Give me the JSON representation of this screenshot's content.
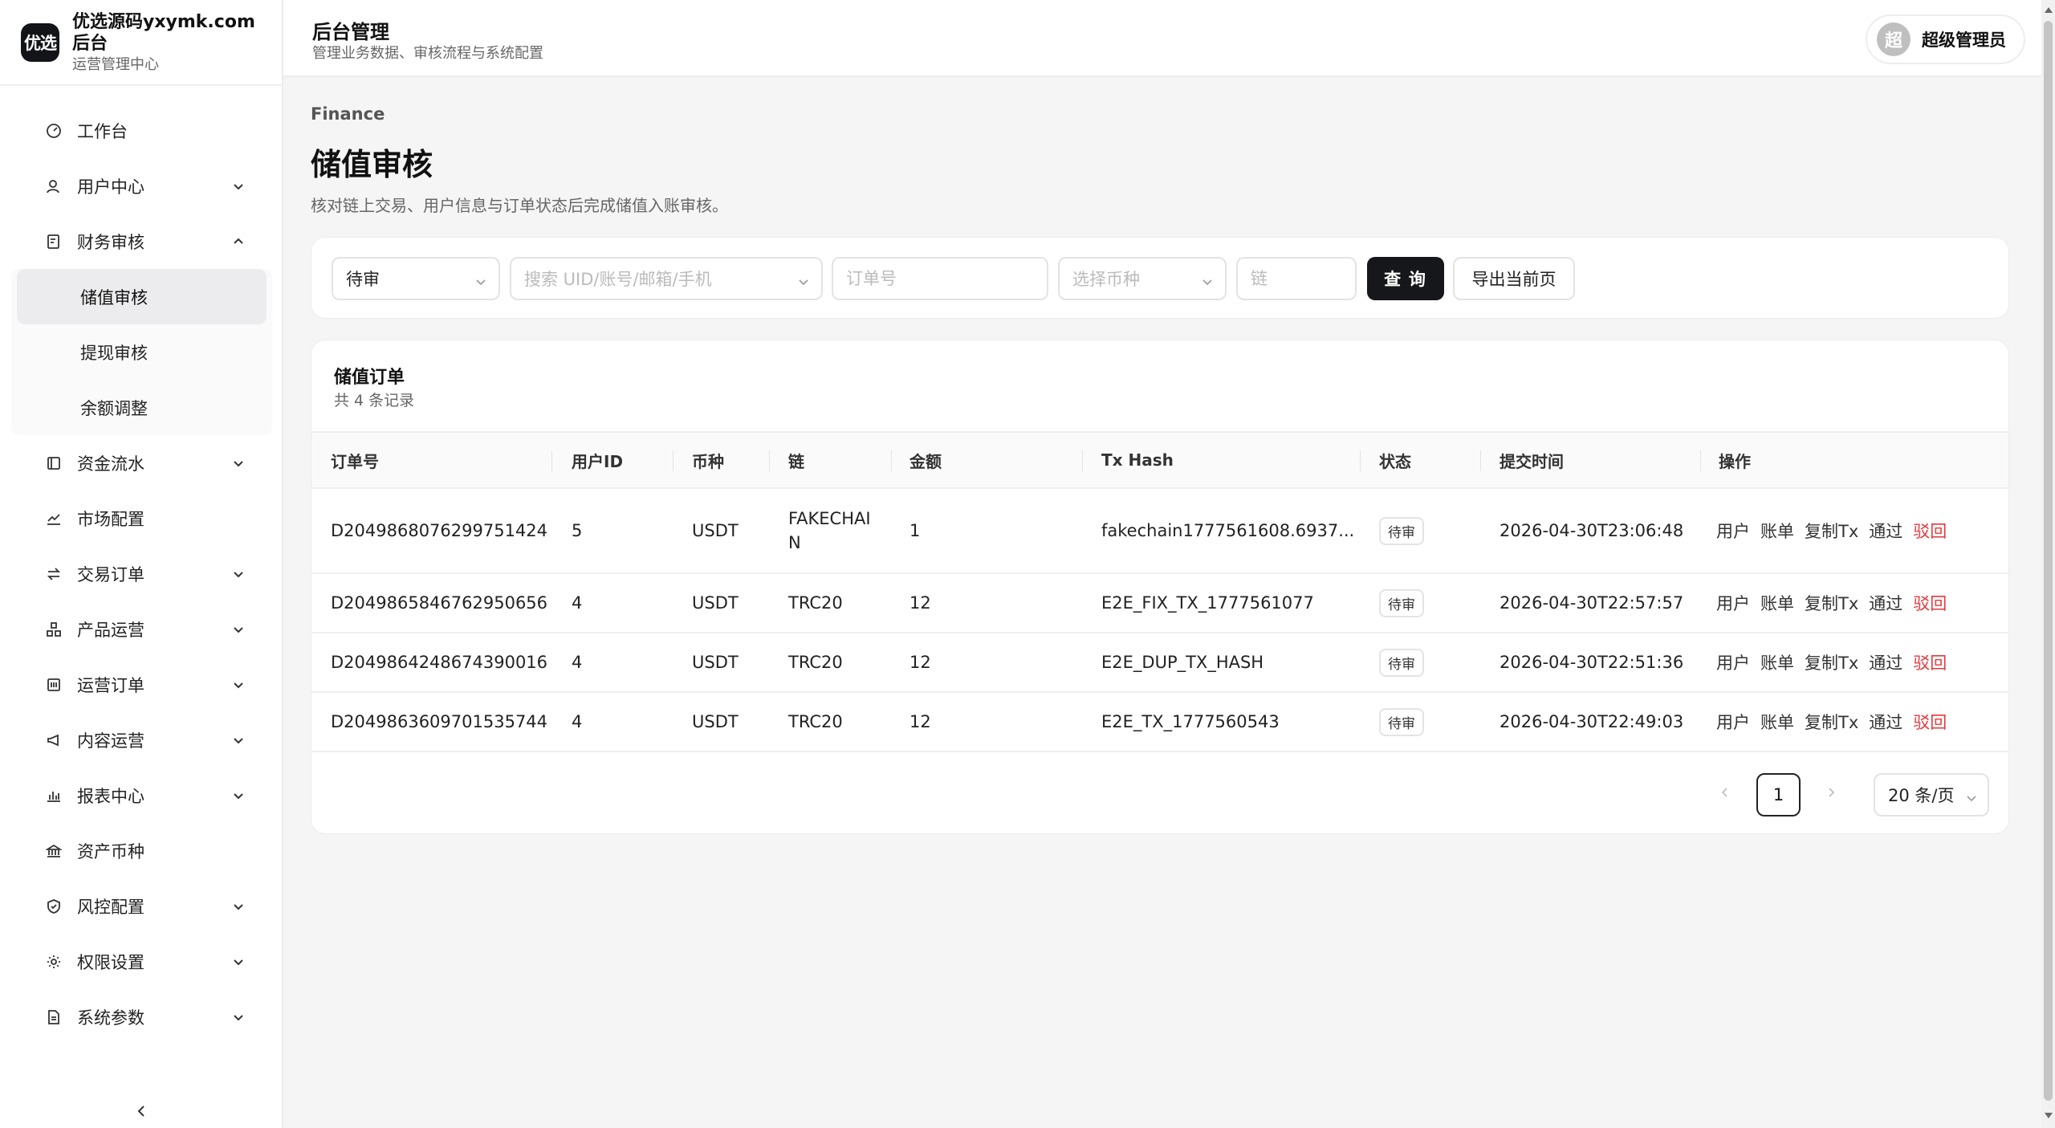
{
  "brand": {
    "logo_text": "优选",
    "title": "优选源码yxymk.com后台",
    "subtitle": "运营管理中心"
  },
  "header": {
    "title": "后台管理",
    "subtitle": "管理业务数据、审核流程与系统配置"
  },
  "user": {
    "avatar_text": "超",
    "name": "超级管理员"
  },
  "sidebar": {
    "items": [
      {
        "label": "工作台",
        "icon": "dashboard-icon"
      },
      {
        "label": "用户中心",
        "icon": "user-icon"
      },
      {
        "label": "财务审核",
        "icon": "finance-doc-icon"
      },
      {
        "label": "资金流水",
        "icon": "ledger-icon"
      },
      {
        "label": "市场配置",
        "icon": "trend-chart-icon"
      },
      {
        "label": "交易订单",
        "icon": "exchange-icon"
      },
      {
        "label": "产品运营",
        "icon": "product-blocks-icon"
      },
      {
        "label": "运营订单",
        "icon": "order-calc-icon"
      },
      {
        "label": "内容运营",
        "icon": "megaphone-icon"
      },
      {
        "label": "报表中心",
        "icon": "bar-chart-icon"
      },
      {
        "label": "资产币种",
        "icon": "bank-icon"
      },
      {
        "label": "风控配置",
        "icon": "shield-icon"
      },
      {
        "label": "权限设置",
        "icon": "gear-icon"
      },
      {
        "label": "系统参数",
        "icon": "document-icon"
      }
    ],
    "finance_sub": [
      "储值审核",
      "提现审核",
      "余额调整"
    ]
  },
  "page": {
    "crumb": "Finance",
    "title": "储值审核",
    "desc": "核对链上交易、用户信息与订单状态后完成储值入账审核。"
  },
  "filters": {
    "status_value": "待审",
    "search_placeholder": "搜索 UID/账号/邮箱/手机",
    "order_placeholder": "订单号",
    "currency_placeholder": "选择币种",
    "chain_placeholder": "链",
    "query_label": "查 询",
    "export_label": "导出当前页"
  },
  "table": {
    "title": "储值订单",
    "count": "共 4 条记录",
    "columns": [
      "订单号",
      "用户ID",
      "币种",
      "链",
      "金额",
      "Tx Hash",
      "状态",
      "提交时间",
      "操作"
    ],
    "rows": [
      {
        "order": "D2049868076299751424",
        "uid": "5",
        "coin": "USDT",
        "chain": "FAKECHAIN",
        "amount": "1",
        "tx": "fakechain1777561608.6937...",
        "status": "待审",
        "time": "2026-04-30T23:06:48"
      },
      {
        "order": "D2049865846762950656",
        "uid": "4",
        "coin": "USDT",
        "chain": "TRC20",
        "amount": "12",
        "tx": "E2E_FIX_TX_1777561077",
        "status": "待审",
        "time": "2026-04-30T22:57:57"
      },
      {
        "order": "D2049864248674390016",
        "uid": "4",
        "coin": "USDT",
        "chain": "TRC20",
        "amount": "12",
        "tx": "E2E_DUP_TX_HASH",
        "status": "待审",
        "time": "2026-04-30T22:51:36"
      },
      {
        "order": "D2049863609701535744",
        "uid": "4",
        "coin": "USDT",
        "chain": "TRC20",
        "amount": "12",
        "tx": "E2E_TX_1777560543",
        "status": "待审",
        "time": "2026-04-30T22:49:03"
      }
    ],
    "actions": [
      "用户",
      "账单",
      "复制Tx",
      "通过",
      "驳回"
    ]
  },
  "pagination": {
    "current": "1",
    "page_size": "20 条/页"
  },
  "colors": {
    "primary": "#16171a",
    "danger": "#e4393c",
    "background": "#f5f5f6"
  }
}
